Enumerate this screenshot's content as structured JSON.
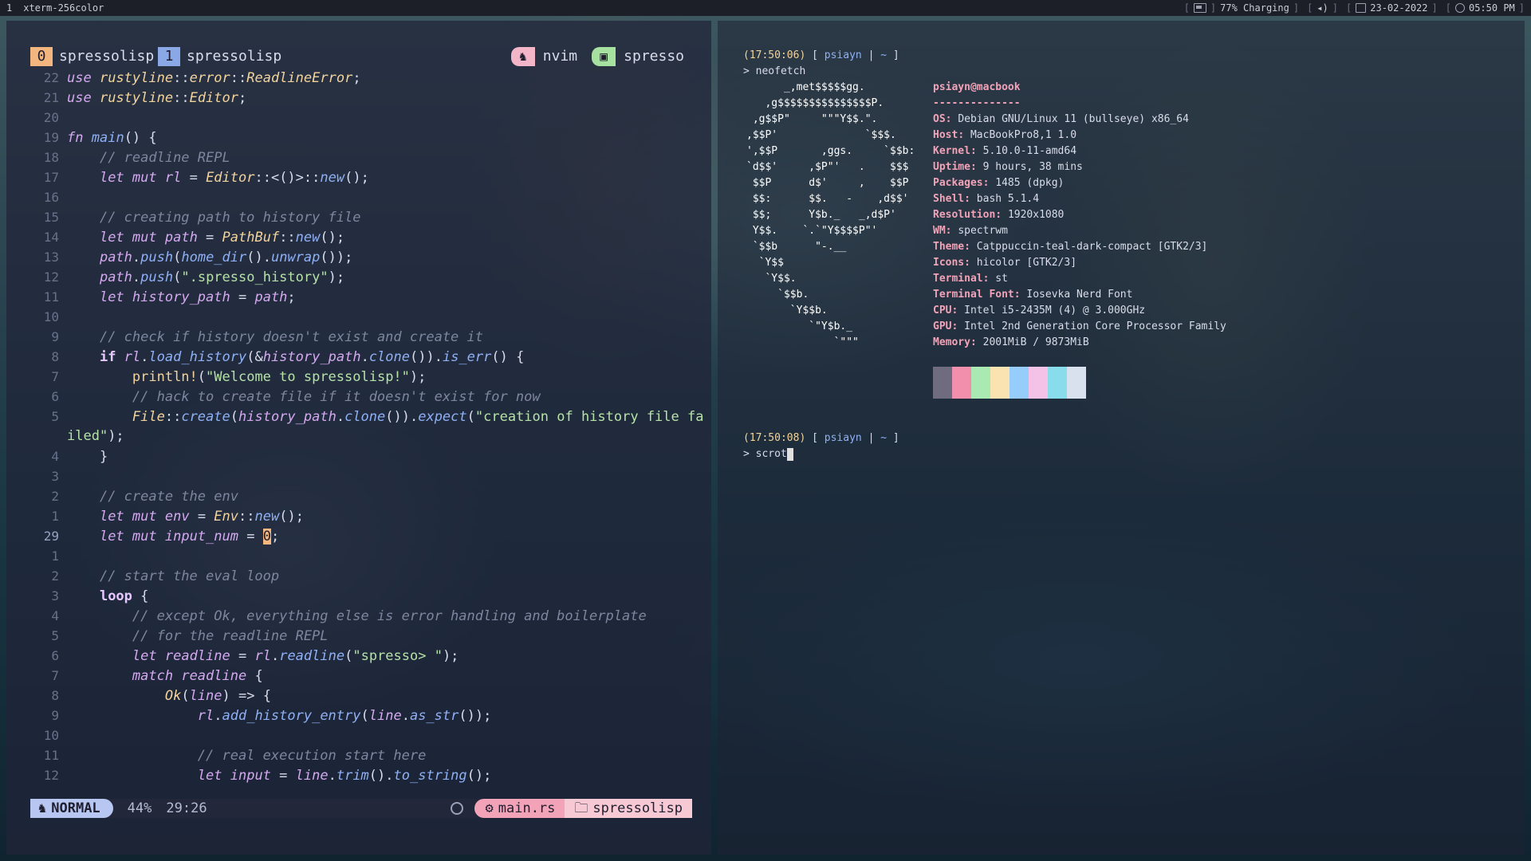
{
  "topbar": {
    "workspace": "1",
    "title": "xterm-256color",
    "battery": "77% Charging",
    "date": "23-02-2022",
    "time": "05:50 PM"
  },
  "editor": {
    "tabs": [
      {
        "num": "0",
        "name": "spressolisp"
      },
      {
        "num": "1",
        "name": "spressolisp"
      }
    ],
    "right_tabs": [
      {
        "icon": "nvim-icon",
        "label": "nvim"
      },
      {
        "icon": "terminal-icon",
        "label": "spresso"
      }
    ],
    "line_numbers": [
      "22",
      "21",
      "20",
      "19",
      "18",
      "17",
      "16",
      "15",
      "14",
      "13",
      "12",
      "11",
      "10",
      "9",
      "8",
      "7",
      "6",
      "5",
      "",
      "4",
      "3",
      "2",
      "1",
      "29",
      "1",
      "2",
      "3",
      "4",
      "5",
      "6",
      "7",
      "8",
      "9",
      "10",
      "11",
      "12"
    ],
    "status": {
      "mode": "NORMAL",
      "percent": "44%",
      "position": "29:26",
      "file": "main.rs",
      "dir": "spressolisp"
    }
  },
  "terminal": {
    "prompt1": {
      "time": "(17:50:06)",
      "user": "psiayn",
      "dir": "~",
      "cmd": "neofetch"
    },
    "prompt2": {
      "time": "(17:50:08)",
      "user": "psiayn",
      "dir": "~",
      "cmd": "scrot"
    },
    "ascii": "      _,met$$$$$gg.\n   ,g$$$$$$$$$$$$$$$P.\n ,g$$P\"     \"\"\"Y$$.\".\n,$$P'              `$$$.\n',$$P       ,ggs.     `$$b:\n`d$$'     ,$P\"'   .    $$$\n $$P      d$'     ,    $$P\n $$:      $$.   -    ,d$$'\n $$;      Y$b._   _,d$P'\n Y$$.    `.`\"Y$$$$P\"'\n `$$b      \"-.__\n  `Y$$\n   `Y$$.\n     `$$b.\n       `Y$$b.\n          `\"Y$b._\n              `\"\"\"",
    "info_title": "psiayn@macbook",
    "info_rule": "--------------",
    "info": [
      {
        "key": "OS",
        "value": "Debian GNU/Linux 11 (bullseye) x86_64"
      },
      {
        "key": "Host",
        "value": "MacBookPro8,1 1.0"
      },
      {
        "key": "Kernel",
        "value": "5.10.0-11-amd64"
      },
      {
        "key": "Uptime",
        "value": "9 hours, 38 mins"
      },
      {
        "key": "Packages",
        "value": "1485 (dpkg)"
      },
      {
        "key": "Shell",
        "value": "bash 5.1.4"
      },
      {
        "key": "Resolution",
        "value": "1920x1080"
      },
      {
        "key": "WM",
        "value": "spectrwm"
      },
      {
        "key": "Theme",
        "value": "Catppuccin-teal-dark-compact [GTK2/3]"
      },
      {
        "key": "Icons",
        "value": "hicolor [GTK2/3]"
      },
      {
        "key": "Terminal",
        "value": "st"
      },
      {
        "key": "Terminal Font",
        "value": "Iosevka Nerd Font"
      },
      {
        "key": "CPU",
        "value": "Intel i5-2435M (4) @ 3.000GHz"
      },
      {
        "key": "GPU",
        "value": "Intel 2nd Generation Core Processor Family"
      },
      {
        "key": "Memory",
        "value": "2001MiB / 9873MiB"
      }
    ],
    "palette": [
      "#6e6c7e",
      "#f28fad",
      "#abe9b3",
      "#fae3b0",
      "#96cdfb",
      "#f5c2e7",
      "#89dceb",
      "#d9e0ee"
    ]
  }
}
